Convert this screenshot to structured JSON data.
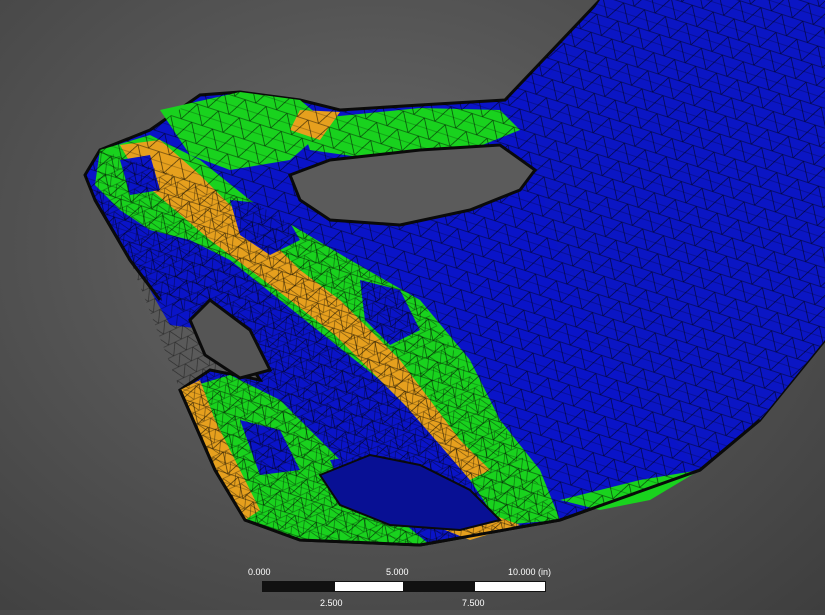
{
  "scale_bar": {
    "top_labels": [
      "0.000",
      "5.000",
      "10.000 (in)"
    ],
    "bottom_labels": [
      "2.500",
      "7.500"
    ]
  },
  "contour_colors": {
    "low": "#0a14c8",
    "mid": "#19d21e",
    "high": "#e6a01e",
    "edge": "#0a0a0a",
    "mesh": "#000000"
  }
}
